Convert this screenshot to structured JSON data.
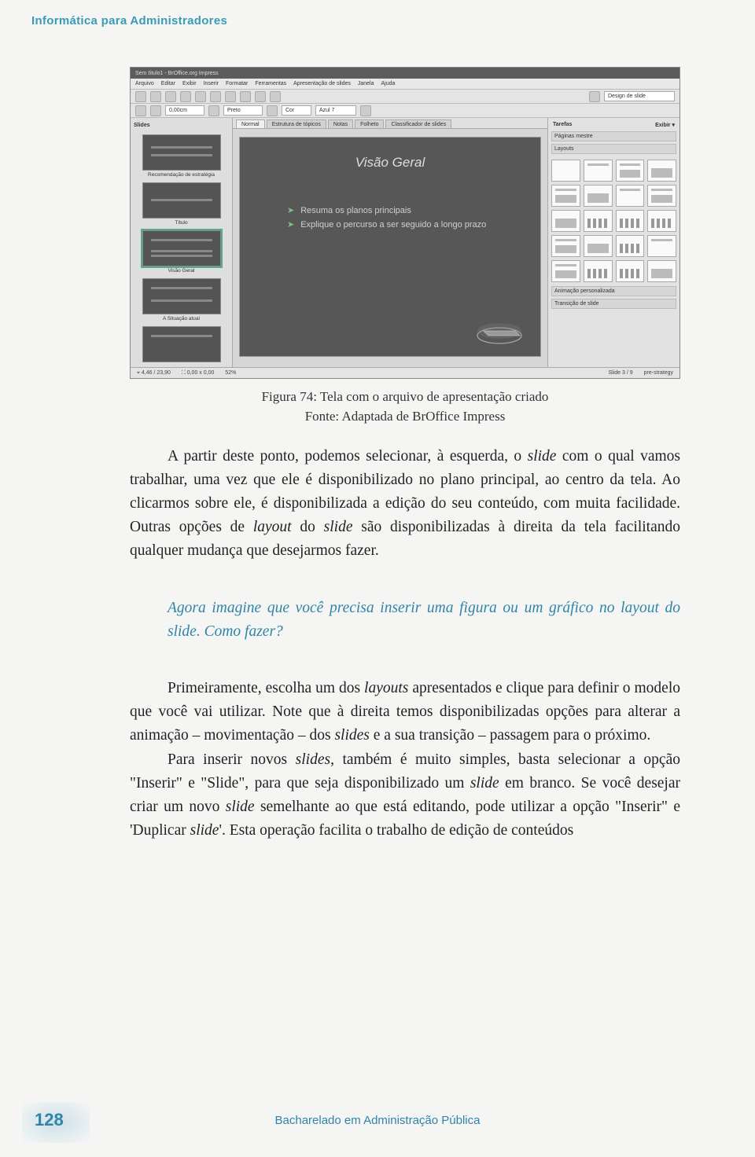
{
  "header": {
    "title": "Informática para Administradores"
  },
  "screenshot": {
    "titlebar": "Sem título1 - BrOffice.org Impress",
    "menus": [
      "Arquivo",
      "Editar",
      "Exibir",
      "Inserir",
      "Formatar",
      "Ferramentas",
      "Apresentação de slides",
      "Janela",
      "Ajuda"
    ],
    "toolbar2": {
      "color_label": "Preto",
      "color_label2": "Cor",
      "color_label3": "Azul 7",
      "design_btn": "Design de slide"
    },
    "tabs": [
      "Normal",
      "Estrutura de tópicos",
      "Notas",
      "Folheto",
      "Classificador de slides"
    ],
    "left_panel": {
      "header": "Slides",
      "thumbs": [
        {
          "label": "Recomendação de estratégia"
        },
        {
          "label": "Título"
        },
        {
          "label": "Visão Geral"
        },
        {
          "label": "A Situação atual"
        },
        {
          "label": ""
        }
      ]
    },
    "canvas": {
      "heading": "Visão Geral",
      "bullets": [
        "Resuma os planos principais",
        "Explique o percurso a ser seguido a longo prazo"
      ]
    },
    "task_pane": {
      "header_left": "Tarefas",
      "header_right": "Exibir ▾",
      "sections_top": [
        "Páginas mestre",
        "Layouts"
      ],
      "sections_bottom": [
        "Animação personalizada",
        "Transição de slide"
      ]
    },
    "statusbar": [
      "⌖  4,46 / 23,90",
      "⛶ 0,00 x 0,00",
      "52%",
      "Slide 3 / 9",
      "pre-strategy"
    ]
  },
  "caption": "Figura 74: Tela com o arquivo de apresentação criado",
  "source": "Fonte: Adaptada de BrOffice Impress",
  "para1_a": "A partir deste ponto, podemos selecionar, à esquerda, o ",
  "para1_b": "slide",
  "para1_c": " com o qual vamos trabalhar, uma vez que ele é disponibilizado no plano principal, ao centro da tela. Ao clicarmos sobre ele, é disponibilizada a edição do seu conteúdo, com muita facilidade. Outras opções de ",
  "para1_d": "layout",
  "para1_e": " do ",
  "para1_f": "slide",
  "para1_g": " são disponibilizadas à direita da tela facilitando qualquer mudança que desejarmos fazer.",
  "callout": "Agora imagine que você precisa inserir uma figura ou um gráfico no layout do slide. Como fazer?",
  "para2_a": "Primeiramente, escolha um dos ",
  "para2_b": "layouts",
  "para2_c": " apresentados e clique para definir o modelo que você vai utilizar. Note que à direita temos disponibilizadas opções para alterar a animação – movimentação – dos ",
  "para2_d": "slides",
  "para2_e": " e a sua transição – passagem para o próximo.",
  "para3_a": "Para inserir novos ",
  "para3_b": "slides",
  "para3_c": ", também é muito simples, basta selecionar a opção \"Inserir\" e \"Slide\", para que seja disponibilizado um ",
  "para3_d": "slide",
  "para3_e": " em branco. Se você desejar criar um novo ",
  "para3_f": "slide",
  "para3_g": " semelhante ao que está editando, pode utilizar a opção \"Inserir\" e 'Duplicar ",
  "para3_h": "slide",
  "para3_i": "'. Esta operação facilita o trabalho de edição de conteúdos",
  "footer": {
    "page": "128",
    "text": "Bacharelado em Administração Pública"
  }
}
